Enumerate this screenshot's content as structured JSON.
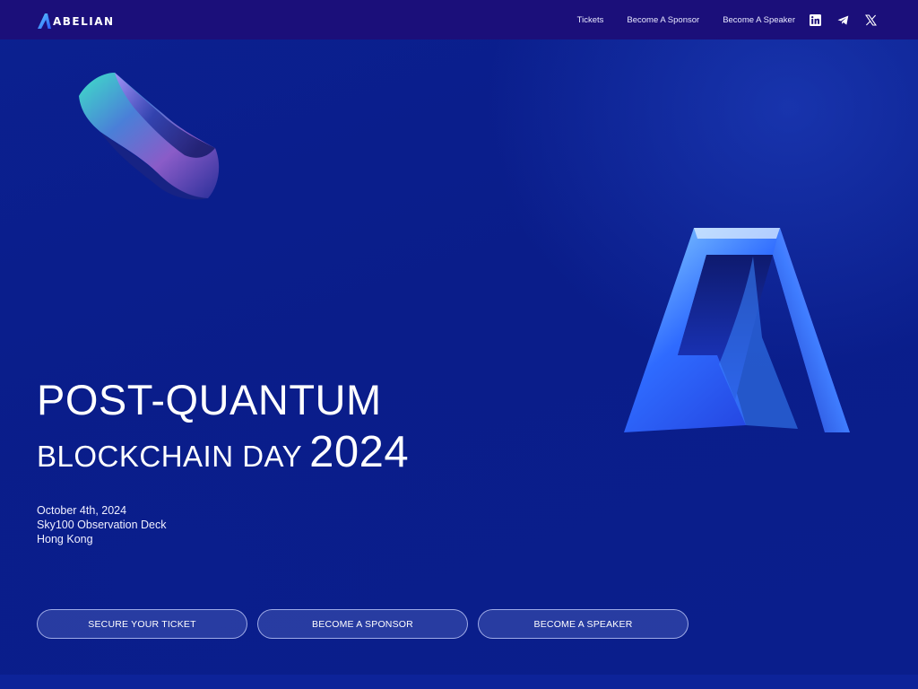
{
  "header": {
    "logo_text": "ABELIAN",
    "nav": [
      {
        "label": "Tickets"
      },
      {
        "label": "Become A Sponsor"
      },
      {
        "label": "Become A Speaker"
      }
    ],
    "social": [
      "linkedin-icon",
      "telegram-icon",
      "x-icon"
    ]
  },
  "hero": {
    "title_line1": "POST-QUANTUM",
    "title_line2": "BLOCKCHAIN DAY",
    "year": "2024"
  },
  "event": {
    "date": "October 4th, 2024",
    "venue": "Sky100 Observation Deck",
    "city": "Hong Kong"
  },
  "buttons": {
    "ticket": "SECURE YOUR TICKET",
    "sponsor": "BECOME A SPONSOR",
    "speaker": "BECOME A SPEAKER"
  },
  "colors": {
    "header_bg": "#1b0f7a",
    "page_bg": "#0a1f8f",
    "accent": "#3aa0ff"
  }
}
